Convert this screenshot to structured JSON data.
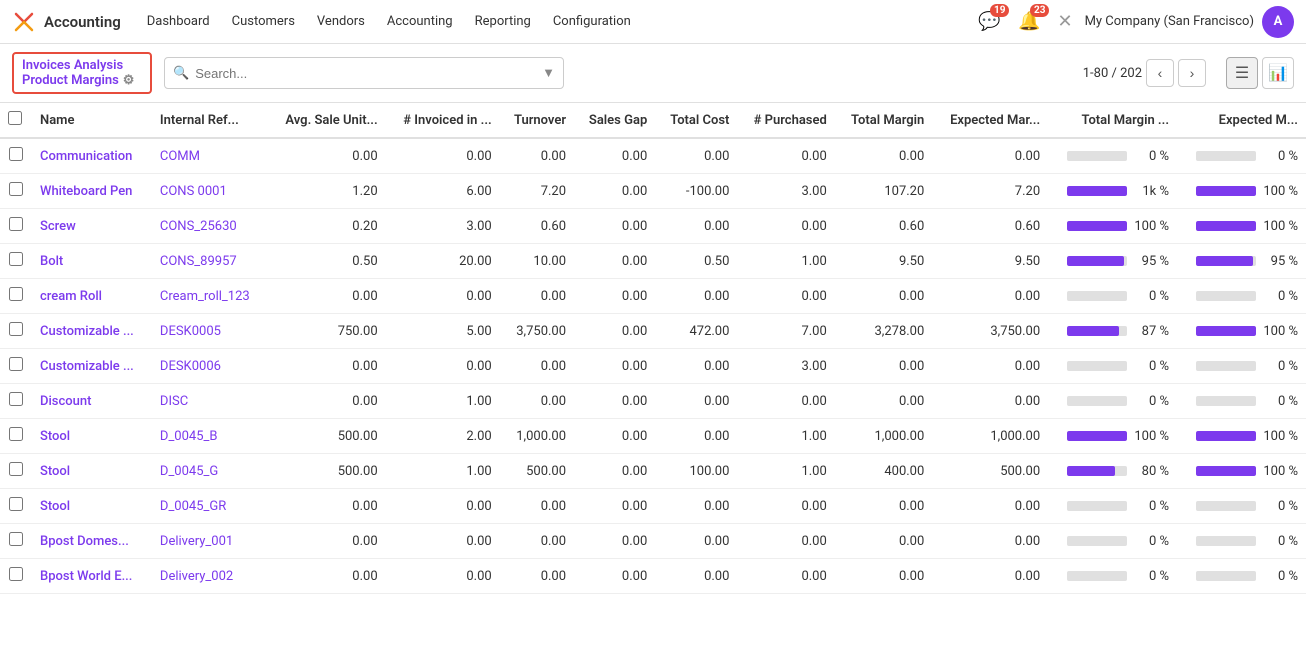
{
  "app": {
    "logo": "X",
    "name": "Accounting"
  },
  "nav": {
    "items": [
      {
        "label": "Dashboard",
        "active": false
      },
      {
        "label": "Customers",
        "active": false
      },
      {
        "label": "Vendors",
        "active": false
      },
      {
        "label": "Accounting",
        "active": false
      },
      {
        "label": "Reporting",
        "active": false
      },
      {
        "label": "Configuration",
        "active": false
      }
    ]
  },
  "topright": {
    "chat_badge": "19",
    "notif_badge": "23",
    "company": "My Company (San Francisco)"
  },
  "breadcrumb": {
    "line1": "Invoices Analysis",
    "line2": "Product Margins"
  },
  "search": {
    "placeholder": "Search..."
  },
  "pagination": {
    "current": "1-80",
    "total": "202"
  },
  "columns": [
    {
      "key": "checkbox",
      "label": ""
    },
    {
      "key": "name",
      "label": "Name"
    },
    {
      "key": "ref",
      "label": "Internal Ref..."
    },
    {
      "key": "avg",
      "label": "Avg. Sale Unit..."
    },
    {
      "key": "invoiced",
      "label": "# Invoiced in ..."
    },
    {
      "key": "turnover",
      "label": "Turnover"
    },
    {
      "key": "sales_gap",
      "label": "Sales Gap"
    },
    {
      "key": "total_cost",
      "label": "Total Cost"
    },
    {
      "key": "purchased",
      "label": "# Purchased"
    },
    {
      "key": "total_margin",
      "label": "Total Margin"
    },
    {
      "key": "expected_mar",
      "label": "Expected Mar..."
    },
    {
      "key": "total_margin_pct",
      "label": "Total Margin ..."
    },
    {
      "key": "expected_m",
      "label": "Expected M..."
    }
  ],
  "rows": [
    {
      "name": "Communication",
      "ref": "COMM",
      "avg": "0.00",
      "invoiced": "0.00",
      "turnover": "0.00",
      "sales_gap": "0.00",
      "total_cost": "0.00",
      "purchased": "0.00",
      "total_margin": "0.00",
      "expected_mar": "0.00",
      "total_margin_pct": "0 %",
      "total_margin_pct_bar": 0,
      "expected_m": "0 %",
      "expected_m_bar": 0
    },
    {
      "name": "Whiteboard Pen",
      "ref": "CONS 0001",
      "avg": "1.20",
      "invoiced": "6.00",
      "turnover": "7.20",
      "sales_gap": "0.00",
      "total_cost": "-100.00",
      "purchased": "3.00",
      "total_margin": "107.20",
      "expected_mar": "7.20",
      "total_margin_pct": "1k %",
      "total_margin_pct_bar": 100,
      "expected_m": "100 %",
      "expected_m_bar": 100
    },
    {
      "name": "Screw",
      "ref": "CONS_25630",
      "avg": "0.20",
      "invoiced": "3.00",
      "turnover": "0.60",
      "sales_gap": "0.00",
      "total_cost": "0.00",
      "purchased": "0.00",
      "total_margin": "0.60",
      "expected_mar": "0.60",
      "total_margin_pct": "100 %",
      "total_margin_pct_bar": 100,
      "expected_m": "100 %",
      "expected_m_bar": 100
    },
    {
      "name": "Bolt",
      "ref": "CONS_89957",
      "avg": "0.50",
      "invoiced": "20.00",
      "turnover": "10.00",
      "sales_gap": "0.00",
      "total_cost": "0.50",
      "purchased": "1.00",
      "total_margin": "9.50",
      "expected_mar": "9.50",
      "total_margin_pct": "95 %",
      "total_margin_pct_bar": 95,
      "expected_m": "95 %",
      "expected_m_bar": 95
    },
    {
      "name": "cream Roll",
      "ref": "Cream_roll_123",
      "avg": "0.00",
      "invoiced": "0.00",
      "turnover": "0.00",
      "sales_gap": "0.00",
      "total_cost": "0.00",
      "purchased": "0.00",
      "total_margin": "0.00",
      "expected_mar": "0.00",
      "total_margin_pct": "0 %",
      "total_margin_pct_bar": 0,
      "expected_m": "0 %",
      "expected_m_bar": 0
    },
    {
      "name": "Customizable ...",
      "ref": "DESK0005",
      "avg": "750.00",
      "invoiced": "5.00",
      "turnover": "3,750.00",
      "sales_gap": "0.00",
      "total_cost": "472.00",
      "purchased": "7.00",
      "total_margin": "3,278.00",
      "expected_mar": "3,750.00",
      "total_margin_pct": "87 %",
      "total_margin_pct_bar": 87,
      "expected_m": "100 %",
      "expected_m_bar": 100
    },
    {
      "name": "Customizable ...",
      "ref": "DESK0006",
      "avg": "0.00",
      "invoiced": "0.00",
      "turnover": "0.00",
      "sales_gap": "0.00",
      "total_cost": "0.00",
      "purchased": "3.00",
      "total_margin": "0.00",
      "expected_mar": "0.00",
      "total_margin_pct": "0 %",
      "total_margin_pct_bar": 0,
      "expected_m": "0 %",
      "expected_m_bar": 0
    },
    {
      "name": "Discount",
      "ref": "DISC",
      "avg": "0.00",
      "invoiced": "1.00",
      "turnover": "0.00",
      "sales_gap": "0.00",
      "total_cost": "0.00",
      "purchased": "0.00",
      "total_margin": "0.00",
      "expected_mar": "0.00",
      "total_margin_pct": "0 %",
      "total_margin_pct_bar": 0,
      "expected_m": "0 %",
      "expected_m_bar": 0
    },
    {
      "name": "Stool",
      "ref": "D_0045_B",
      "avg": "500.00",
      "invoiced": "2.00",
      "turnover": "1,000.00",
      "sales_gap": "0.00",
      "total_cost": "0.00",
      "purchased": "1.00",
      "total_margin": "1,000.00",
      "expected_mar": "1,000.00",
      "total_margin_pct": "100 %",
      "total_margin_pct_bar": 100,
      "expected_m": "100 %",
      "expected_m_bar": 100
    },
    {
      "name": "Stool",
      "ref": "D_0045_G",
      "avg": "500.00",
      "invoiced": "1.00",
      "turnover": "500.00",
      "sales_gap": "0.00",
      "total_cost": "100.00",
      "purchased": "1.00",
      "total_margin": "400.00",
      "expected_mar": "500.00",
      "total_margin_pct": "80 %",
      "total_margin_pct_bar": 80,
      "expected_m": "100 %",
      "expected_m_bar": 100
    },
    {
      "name": "Stool",
      "ref": "D_0045_GR",
      "avg": "0.00",
      "invoiced": "0.00",
      "turnover": "0.00",
      "sales_gap": "0.00",
      "total_cost": "0.00",
      "purchased": "0.00",
      "total_margin": "0.00",
      "expected_mar": "0.00",
      "total_margin_pct": "0 %",
      "total_margin_pct_bar": 0,
      "expected_m": "0 %",
      "expected_m_bar": 0
    },
    {
      "name": "Bpost Domes...",
      "ref": "Delivery_001",
      "avg": "0.00",
      "invoiced": "0.00",
      "turnover": "0.00",
      "sales_gap": "0.00",
      "total_cost": "0.00",
      "purchased": "0.00",
      "total_margin": "0.00",
      "expected_mar": "0.00",
      "total_margin_pct": "0 %",
      "total_margin_pct_bar": 0,
      "expected_m": "0 %",
      "expected_m_bar": 0
    },
    {
      "name": "Bpost World E...",
      "ref": "Delivery_002",
      "avg": "0.00",
      "invoiced": "0.00",
      "turnover": "0.00",
      "sales_gap": "0.00",
      "total_cost": "0.00",
      "purchased": "0.00",
      "total_margin": "0.00",
      "expected_mar": "0.00",
      "total_margin_pct": "0 %",
      "total_margin_pct_bar": 0,
      "expected_m": "0 %",
      "expected_m_bar": 0
    }
  ]
}
